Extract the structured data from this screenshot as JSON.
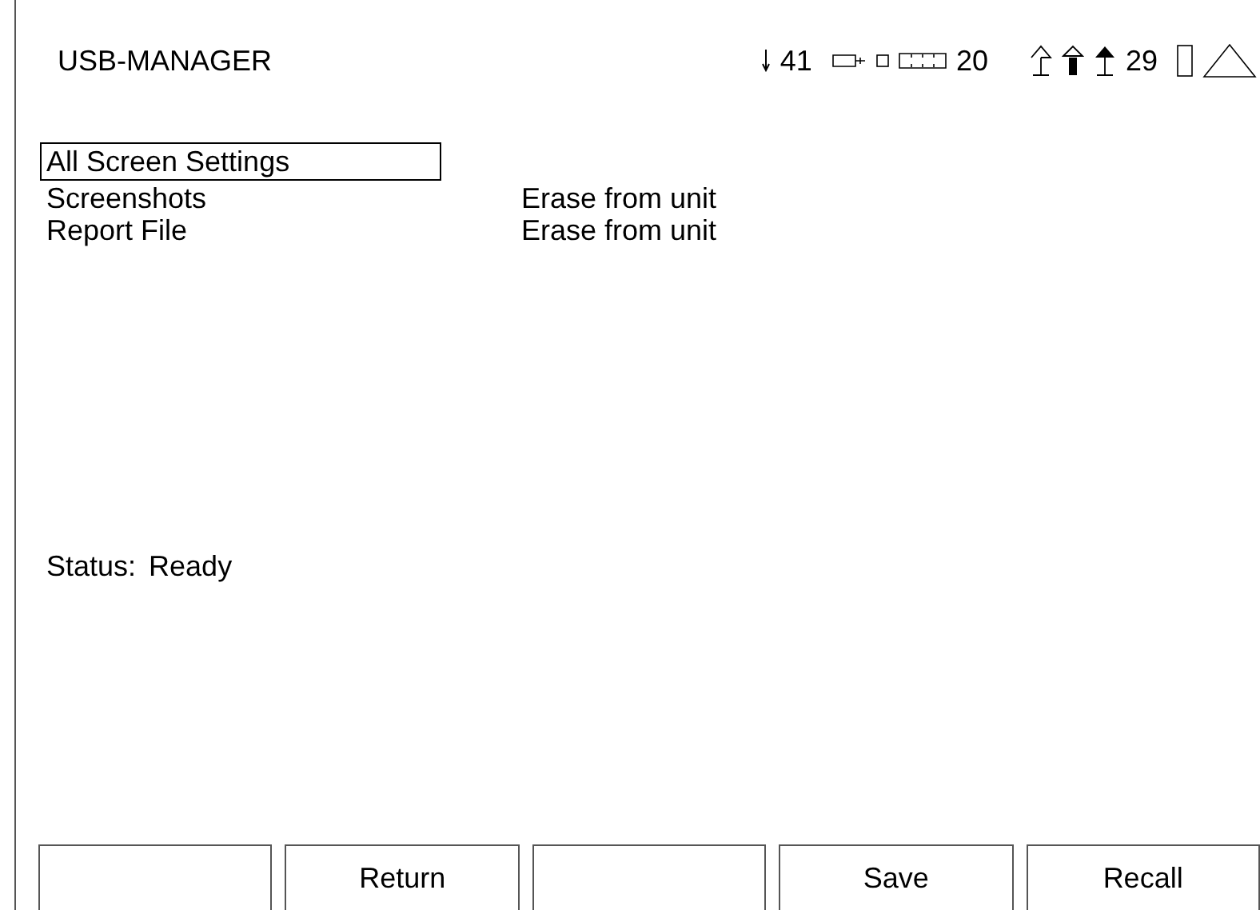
{
  "header": {
    "title": "USB-MANAGER",
    "readings": [
      "41",
      "20",
      "29"
    ]
  },
  "menu": [
    {
      "label": "All Screen Settings",
      "selected": true
    },
    {
      "label": "Screenshots",
      "value": "Erase from unit",
      "selected": false
    },
    {
      "label": "Report File",
      "value": "Erase from unit",
      "selected": false
    }
  ],
  "status": {
    "label": "Status:",
    "value": "Ready"
  },
  "softkeys": [
    {
      "kind": "blank"
    },
    {
      "kind": "labeled",
      "label": "Return"
    },
    {
      "kind": "blank"
    },
    {
      "kind": "labeled",
      "label": "Save"
    },
    {
      "kind": "labeled",
      "label": "Recall"
    }
  ]
}
